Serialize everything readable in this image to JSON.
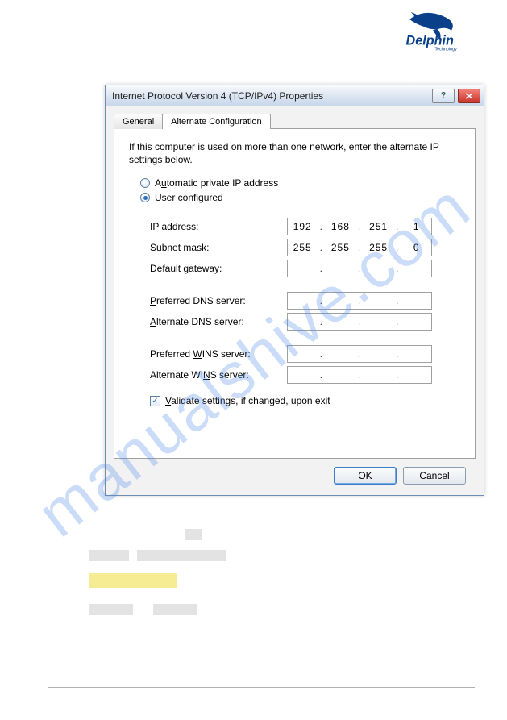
{
  "logo": {
    "main": "Delphin",
    "sub": "Technology"
  },
  "watermark": "manualshive.com",
  "dialog": {
    "title": "Internet Protocol Version 4 (TCP/IPv4) Properties",
    "tabs": {
      "general": "General",
      "alt": "Alternate Configuration"
    },
    "instruction": "If this computer is used on more than one network, enter the alternate IP settings below.",
    "radio_auto": "Automatic private IP address",
    "radio_user": "User configured",
    "labels": {
      "ip": "IP address:",
      "subnet": "Subnet mask:",
      "gateway": "Default gateway:",
      "pdns": "Preferred DNS server:",
      "adns": "Alternate DNS server:",
      "pwins": "Preferred WINS server:",
      "awins": "Alternate WINS server:"
    },
    "values": {
      "ip": [
        "192",
        "168",
        "251",
        "1"
      ],
      "subnet": [
        "255",
        "255",
        "255",
        "0"
      ],
      "gateway": [
        "",
        "",
        "",
        ""
      ],
      "pdns": [
        "",
        "",
        "",
        ""
      ],
      "adns": [
        "",
        "",
        "",
        ""
      ],
      "pwins": [
        "",
        "",
        "",
        ""
      ],
      "awins": [
        "",
        "",
        "",
        ""
      ]
    },
    "validate": "Validate settings, if changed, upon exit",
    "ok": "OK",
    "cancel": "Cancel"
  }
}
